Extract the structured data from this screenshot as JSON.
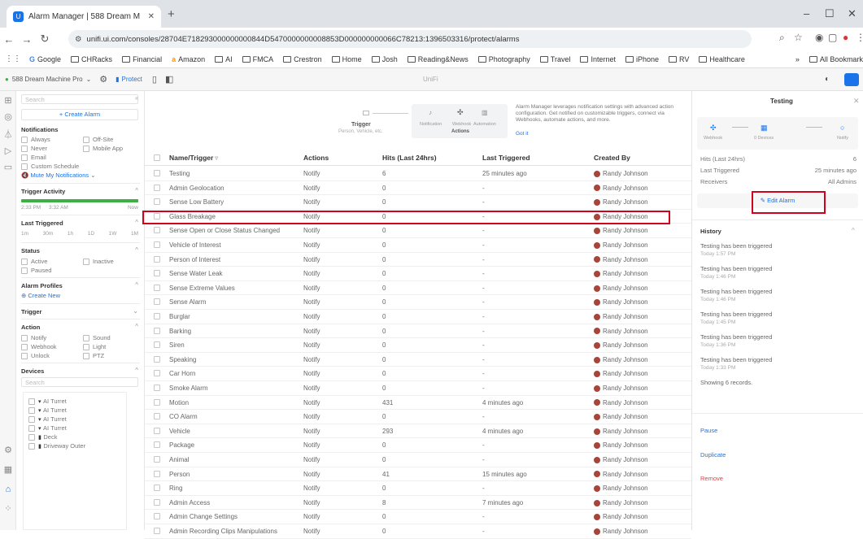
{
  "browser": {
    "tab_title": "Alarm Manager | 588 Dream M",
    "tab_close": "✕",
    "new_tab": "+",
    "url": "unifi.ui.com/consoles/28704E718293000000000844D5470000000008853D000000000066C78213:1396503316/protect/alarms",
    "bookmarks": [
      "Google",
      "CHRacks",
      "Financial",
      "Amazon",
      "AI",
      "FMCA",
      "Crestron",
      "Home",
      "Josh",
      "Reading&News",
      "Photography",
      "Travel",
      "Internet",
      "iPhone",
      "RV",
      "Healthcare"
    ],
    "bookmarks_more": "»",
    "all_bookmarks": "All Bookmarks"
  },
  "unifi": {
    "console": "588 Dream Machine Pro",
    "app": "Protect",
    "center": "UniFi"
  },
  "filters": {
    "search_placeholder": "Search",
    "create_alarm": "Create Alarm",
    "notifications": {
      "title": "Notifications",
      "items": [
        "Always",
        "Never",
        "Email",
        "Custom Schedule"
      ],
      "items2": [
        "Off-Site",
        "Mobile App"
      ],
      "mute": "Mute My Notifications"
    },
    "trigger_activity": {
      "title": "Trigger Activity",
      "left": "2:33 PM",
      "mid": "3:32 AM",
      "right": "Now"
    },
    "last_triggered": {
      "title": "Last Triggered",
      "ranges": [
        "1m",
        "30m",
        "1h",
        "1D",
        "1W",
        "1M"
      ]
    },
    "status": {
      "title": "Status",
      "items": [
        "Active",
        "Paused"
      ],
      "items2": [
        "Inactive"
      ]
    },
    "alarm_profiles": {
      "title": "Alarm Profiles",
      "create": "Create New"
    },
    "trigger": {
      "title": "Trigger"
    },
    "action": {
      "title": "Action",
      "items": [
        "Notify",
        "Webhook",
        "Unlock"
      ],
      "items2": [
        "Sound",
        "Light",
        "PTZ"
      ]
    },
    "devices": {
      "title": "Devices",
      "search": "Search",
      "items": [
        "AI Turret",
        "AI Turret",
        "AI Turret",
        "AI Turret",
        "Deck",
        "Driveway Outer"
      ]
    }
  },
  "wizard": {
    "trigger": "Trigger",
    "trigger_sub": "Person, Vehicle, etc.",
    "notification": "Notification",
    "webhook": "Webhook",
    "automation": "Automation",
    "actions": "Actions",
    "info": "Alarm Manager leverages notification settings with advanced action configuration. Get notified on customizable triggers, connect via Webhooks, automate actions, and more.",
    "got_it": "Got it"
  },
  "table": {
    "headers": [
      "Name/Trigger",
      "Actions",
      "Hits (Last 24hrs)",
      "Last Triggered",
      "Created By"
    ],
    "rows": [
      [
        "Testing",
        "Notify",
        "6",
        "25 minutes ago",
        "Randy Johnson"
      ],
      [
        "Admin Geolocation",
        "Notify",
        "0",
        "-",
        "Randy Johnson"
      ],
      [
        "Sense Low Battery",
        "Notify",
        "0",
        "-",
        "Randy Johnson"
      ],
      [
        "Glass Breakage",
        "Notify",
        "0",
        "-",
        "Randy Johnson"
      ],
      [
        "Sense Open or Close Status Changed",
        "Notify",
        "0",
        "-",
        "Randy Johnson"
      ],
      [
        "Vehicle of Interest",
        "Notify",
        "0",
        "-",
        "Randy Johnson"
      ],
      [
        "Person of Interest",
        "Notify",
        "0",
        "-",
        "Randy Johnson"
      ],
      [
        "Sense Water Leak",
        "Notify",
        "0",
        "-",
        "Randy Johnson"
      ],
      [
        "Sense Extreme Values",
        "Notify",
        "0",
        "-",
        "Randy Johnson"
      ],
      [
        "Sense Alarm",
        "Notify",
        "0",
        "-",
        "Randy Johnson"
      ],
      [
        "Burglar",
        "Notify",
        "0",
        "-",
        "Randy Johnson"
      ],
      [
        "Barking",
        "Notify",
        "0",
        "-",
        "Randy Johnson"
      ],
      [
        "Siren",
        "Notify",
        "0",
        "-",
        "Randy Johnson"
      ],
      [
        "Speaking",
        "Notify",
        "0",
        "-",
        "Randy Johnson"
      ],
      [
        "Car Horn",
        "Notify",
        "0",
        "-",
        "Randy Johnson"
      ],
      [
        "Smoke Alarm",
        "Notify",
        "0",
        "-",
        "Randy Johnson"
      ],
      [
        "Motion",
        "Notify",
        "431",
        "4 minutes ago",
        "Randy Johnson"
      ],
      [
        "CO Alarm",
        "Notify",
        "0",
        "-",
        "Randy Johnson"
      ],
      [
        "Vehicle",
        "Notify",
        "293",
        "4 minutes ago",
        "Randy Johnson"
      ],
      [
        "Package",
        "Notify",
        "0",
        "-",
        "Randy Johnson"
      ],
      [
        "Animal",
        "Notify",
        "0",
        "-",
        "Randy Johnson"
      ],
      [
        "Person",
        "Notify",
        "41",
        "15 minutes ago",
        "Randy Johnson"
      ],
      [
        "Ring",
        "Notify",
        "0",
        "-",
        "Randy Johnson"
      ],
      [
        "Admin Access",
        "Notify",
        "8",
        "7 minutes ago",
        "Randy Johnson"
      ],
      [
        "Admin Change Settings",
        "Notify",
        "0",
        "-",
        "Randy Johnson"
      ],
      [
        "Admin Recording Clips Manipulations",
        "Notify",
        "0",
        "-",
        "Randy Johnson"
      ]
    ]
  },
  "detail": {
    "title": "Testing",
    "flow": [
      "Webhook",
      "0 Devices",
      "Notify"
    ],
    "hits_label": "Hits (Last 24hrs)",
    "hits_value": "6",
    "last_label": "Last Triggered",
    "last_value": "25 minutes ago",
    "recv_label": "Receivers",
    "recv_value": "All Admins",
    "edit": "Edit Alarm",
    "history_title": "History",
    "history": [
      {
        "t": "Testing has been triggered",
        "s": "Today 1:57 PM"
      },
      {
        "t": "Testing has been triggered",
        "s": "Today 1:46 PM"
      },
      {
        "t": "Testing has been triggered",
        "s": "Today 1:46 PM"
      },
      {
        "t": "Testing has been triggered",
        "s": "Today 1:45 PM"
      },
      {
        "t": "Testing has been triggered",
        "s": "Today 1:36 PM"
      },
      {
        "t": "Testing has been triggered",
        "s": "Today 1:33 PM"
      }
    ],
    "showing": "Showing 6 records.",
    "pause": "Pause",
    "duplicate": "Duplicate",
    "remove": "Remove"
  },
  "colors": {
    "accent": "#1a73e8",
    "highlight": "#d0021b",
    "activity": "#3cb043"
  }
}
